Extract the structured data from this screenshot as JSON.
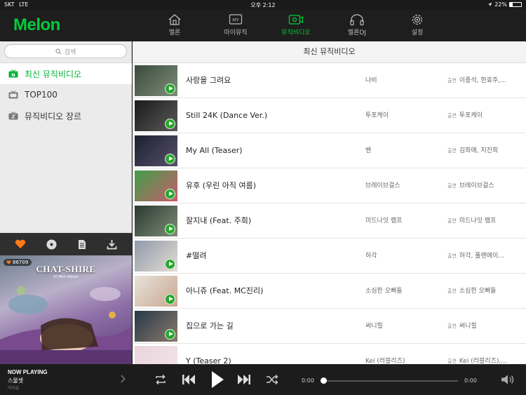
{
  "status_bar": {
    "carrier": "SKT",
    "network": "LTE",
    "time": "오후 2:12",
    "battery": "22%",
    "battery_level": 0.22
  },
  "app": {
    "logo": "Melon"
  },
  "nav": {
    "tabs": [
      {
        "label": "멜론",
        "icon": "home-icon"
      },
      {
        "label": "마이뮤직",
        "icon": "my-music-icon"
      },
      {
        "label": "뮤직비디오",
        "icon": "music-video-icon",
        "active": true
      },
      {
        "label": "멜론DJ",
        "icon": "headphones-icon"
      },
      {
        "label": "설정",
        "icon": "gear-icon"
      }
    ]
  },
  "sidebar": {
    "search_placeholder": "검색",
    "items": [
      {
        "label": "최신 뮤직비디오",
        "icon": "new-badge-icon",
        "active": true
      },
      {
        "label": "TOP100",
        "icon": "tv-icon"
      },
      {
        "label": "뮤직비디오 장르",
        "icon": "genre-icon"
      }
    ]
  },
  "player": {
    "icons": [
      "heart-icon",
      "disc-icon",
      "lyrics-icon",
      "download-icon"
    ],
    "likes": "86709",
    "album_title": "CHAT-SHIRE",
    "album_subtitle": "IU Mini Album",
    "now_playing_label": "NOW PLAYING",
    "song": "스물셋",
    "artist": "아이유",
    "time_current": "0:00",
    "time_total": "0:00"
  },
  "main": {
    "title": "최신 뮤직비디오",
    "cast_label": "출연",
    "rows": [
      {
        "title": "사랑을 그려요",
        "artist": "나비",
        "cast": "이종석, 한효주,…",
        "thumb": [
          "#3a4a3c",
          "#7d8f7a"
        ]
      },
      {
        "title": "Still 24K (Dance Ver.)",
        "artist": "투포케이",
        "cast": "투포케이",
        "thumb": [
          "#1a1a1a",
          "#5a5a5a"
        ]
      },
      {
        "title": "My All (Teaser)",
        "artist": "벤",
        "cast": "김희애, 지진희",
        "thumb": [
          "#1c2030",
          "#56506a"
        ]
      },
      {
        "title": "유후 (우린 아직 여름)",
        "artist": "브레이브걸스",
        "cast": "브레이브걸스",
        "thumb": [
          "#3fa04a",
          "#c85a6a"
        ]
      },
      {
        "title": "잘지내 (Feat. 주희)",
        "artist": "미드나잇 램프",
        "cast": "미드나잇 램프",
        "thumb": [
          "#2a3a30",
          "#7f8c78"
        ]
      },
      {
        "title": "#떨려",
        "artist": "허각",
        "cast": "허각, 플랜에이…",
        "thumb": [
          "#8f9aaa",
          "#e4dbd4"
        ]
      },
      {
        "title": "아니쥬 (Feat. MC진리)",
        "artist": "소심한 오빠들",
        "cast": "소심한 오빠들",
        "thumb": [
          "#e8e2dc",
          "#c9a78f"
        ]
      },
      {
        "title": "집으로 가는 길",
        "artist": "써니힐",
        "cast": "써니힐",
        "thumb": [
          "#263848",
          "#8b7a6c"
        ]
      },
      {
        "title": "Y (Teaser 2)",
        "artist": "Kei (러블리즈)",
        "cast": "Kei (러블리즈),…",
        "thumb": [
          "#e9d4dc",
          "#f3e5ea"
        ]
      }
    ]
  },
  "colors": {
    "accent": "#00cd3c",
    "bar": "#1e1e1e"
  }
}
